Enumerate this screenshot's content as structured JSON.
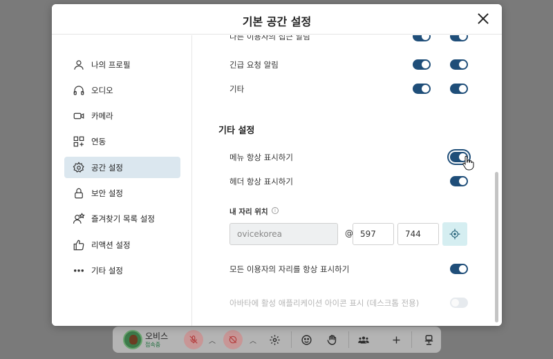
{
  "dialog": {
    "title": "기본 공간 설정"
  },
  "sidebar": {
    "items": [
      {
        "label": "나의 프로필",
        "icon": "user-icon"
      },
      {
        "label": "오디오",
        "icon": "headphones-icon"
      },
      {
        "label": "카메라",
        "icon": "camera-icon"
      },
      {
        "label": "연동",
        "icon": "apps-add-icon"
      },
      {
        "label": "공간 설정",
        "icon": "gear-icon",
        "active": true
      },
      {
        "label": "보안 설정",
        "icon": "lock-icon"
      },
      {
        "label": "즐겨찾기 목록 설정",
        "icon": "user-star-icon"
      },
      {
        "label": "리액션 설정",
        "icon": "thumbs-up-icon"
      },
      {
        "label": "기타 설정",
        "icon": "more-icon"
      }
    ]
  },
  "notifications": {
    "rows": [
      {
        "label": "다른 이용자의 접근 알림",
        "toggle_a": true,
        "toggle_b": true
      },
      {
        "label": "긴급 요청 알림",
        "toggle_a": true,
        "toggle_b": true
      },
      {
        "label": "기타",
        "toggle_a": true,
        "toggle_b": true
      }
    ]
  },
  "other_settings": {
    "title": "기타 설정",
    "show_menu_label": "메뉴 항상 표시하기",
    "show_menu_on": true,
    "show_header_label": "헤더 항상 표시하기",
    "show_header_on": true,
    "my_position_label": "내 자리 위치",
    "space_name": "ovicekorea",
    "at": "@",
    "pos_x": "597",
    "pos_y": "744",
    "show_all_seats_label": "모든 이용자의 자리를 항상 표시하기",
    "show_all_seats_on": true,
    "avatar_app_icon_label": "아바타에 활성 애플리케이션 아이콘 표시 (데스크톱 전용)",
    "avatar_app_icon_on": false
  },
  "bottom_bar": {
    "user_name": "오비스",
    "status": "접속중"
  },
  "colors": {
    "accent": "#1f4e79",
    "active_nav": "#dbe7ef",
    "locate_bg": "#d5eef1"
  }
}
